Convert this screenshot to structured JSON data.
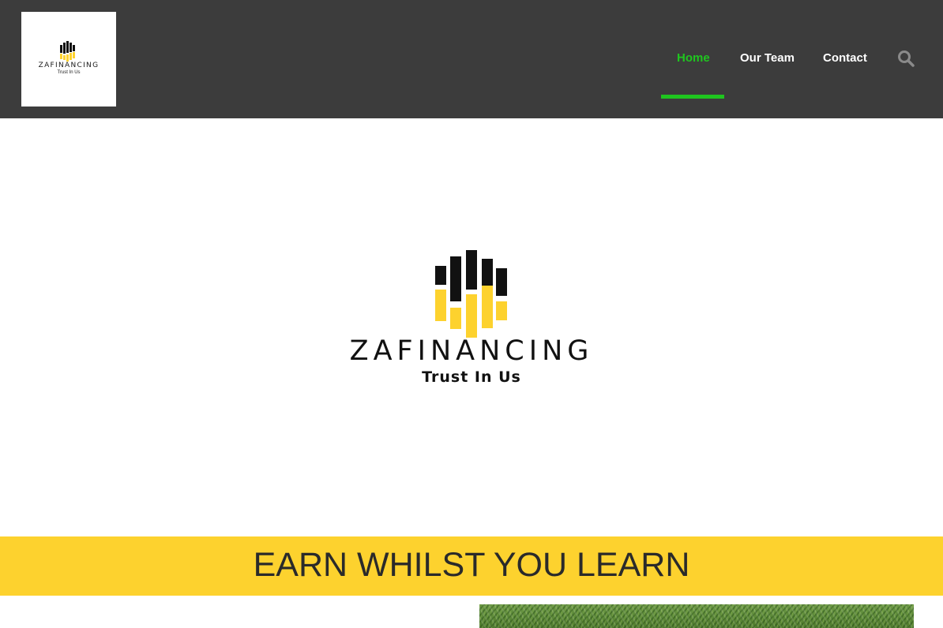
{
  "brand": {
    "name": "ZAFINANCING",
    "tagline": "Trust In Us",
    "black_color": "#111111",
    "yellow_color": "#fdd22e"
  },
  "nav": {
    "items": [
      {
        "label": "Home",
        "active": true
      },
      {
        "label": "Our Team",
        "active": false
      },
      {
        "label": "Contact",
        "active": false
      }
    ],
    "search_icon": "search-icon",
    "active_color": "#1fc51f",
    "background": "#3c3c3c"
  },
  "hero": {
    "title": "ZAFINANCING",
    "tagline": "Trust In Us"
  },
  "banner": {
    "text": "EARN WHILST YOU LEARN",
    "background": "#fdd22e"
  }
}
